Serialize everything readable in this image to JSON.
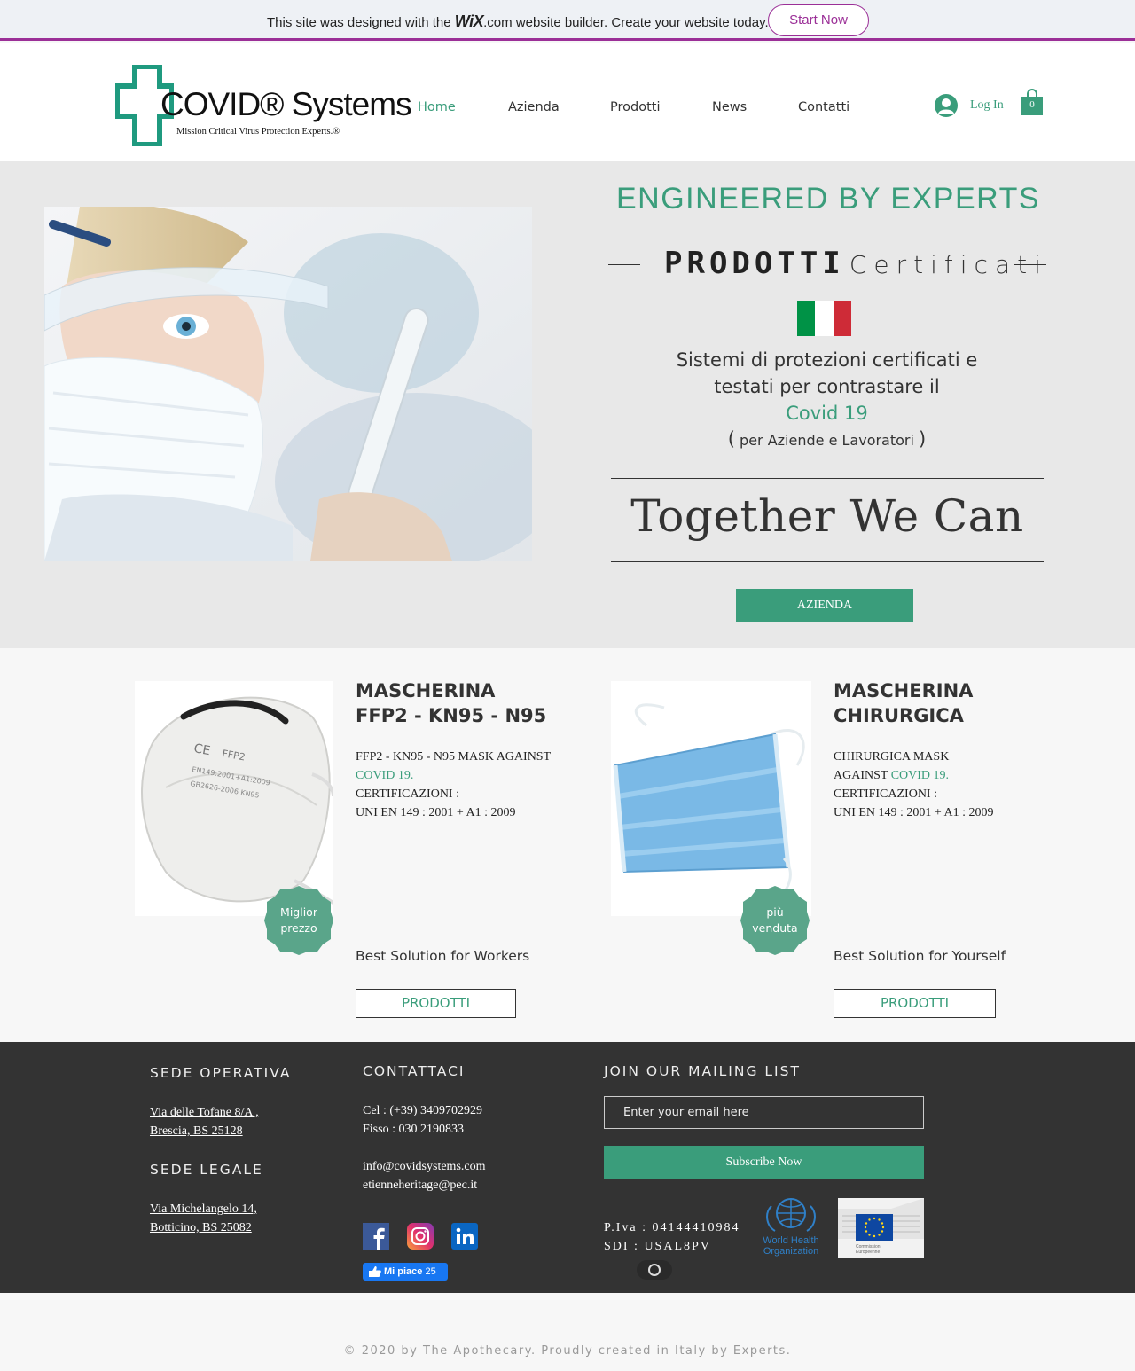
{
  "wix_banner": {
    "text_before": "This site was designed with the ",
    "logo": "WiX",
    "text_after": ".com website builder. Create your website today.",
    "start_button": "Start Now"
  },
  "header": {
    "logo_title": "COVID® Systems",
    "logo_tagline": "Mission Critical Virus Protection Experts.®",
    "nav": [
      "Home",
      "Azienda",
      "Prodotti",
      "News",
      "Contatti"
    ],
    "active_nav": "Home",
    "login_label": "Log In",
    "cart_count": "0"
  },
  "hero": {
    "title": "ENGINEERED BY EXPERTS",
    "cert_bold": "PRODOTTI",
    "cert_light": "Certificati",
    "desc_line1": "Sistemi di protezioni certificati e",
    "desc_line2": "testati per contrastare il",
    "desc_line3": "Covid 19",
    "sub_open": "(",
    "sub_text": "per Aziende e Lavoratori",
    "sub_close": ")",
    "slogan": "Together We Can",
    "button": "AZIENDA"
  },
  "products": [
    {
      "title_line1": "MASCHERINA",
      "title_line2": "FFP2 - KN95 - N95",
      "desc_line1": "FFP2 - KN95 - N95 MASK AGAINST",
      "desc_line2": "COVID 19.",
      "desc_line3": "CERTIFICAZIONI :",
      "desc_line4": "UNI EN 149 : 2001 + A1 : 2009",
      "badge_line1": "Miglior",
      "badge_line2": "prezzo",
      "tagline": "Best Solution for Workers",
      "button": "PRODOTTI"
    },
    {
      "title_line1": "MASCHERINA",
      "title_line2": "CHIRURGICA",
      "desc_line1": "CHIRURGICA MASK",
      "desc_line2a": "AGAINST ",
      "desc_line2b": "COVID 19.",
      "desc_line3": "CERTIFICAZIONI :",
      "desc_line4": "UNI EN 149 : 2001 + A1 : 2009",
      "badge_line1": "più",
      "badge_line2": "venduta",
      "tagline": "Best Solution for Yourself",
      "button": "PRODOTTI"
    }
  ],
  "mask_print": {
    "ce": "CE",
    "ffp2": "FFP2",
    "std1": "EN149:2001+A1:2009",
    "std2": "GB2626-2006  KN95"
  },
  "footer": {
    "sede_operativa": "SEDE OPERATIVA",
    "operativa_line1": "Via delle Tofane 8/A ,",
    "operativa_line2": "Brescia, BS 25128",
    "sede_legale": "SEDE LEGALE",
    "legale_line1": "Via Michelangelo 14,",
    "legale_line2": "Botticino, BS 25082",
    "contattaci": "CONTATTACI",
    "cel": "Cel : (+39) 3409702929",
    "fisso": "Fisso : 030 2190833",
    "email1": "info@covidsystems.com",
    "email2": "etienneheritage@pec.it",
    "fb_like_label": "Mi piace",
    "fb_like_count": "25",
    "mailing_title": "JOIN OUR MAILING LIST",
    "email_placeholder": "Enter your email here",
    "subscribe": "Subscribe Now",
    "piva": "P.Iva : 04144410984",
    "sdi": "SDI : USAL8PV",
    "who_line1": "World Health",
    "who_line2": "Organization",
    "eu_line1": "Commission",
    "eu_line2": "Européenne"
  },
  "copyright": "© 2020 by The Apothecary.  Proudly created in Italy by Experts.",
  "colors": {
    "accent": "#3a9d7b",
    "wix_purple": "#9b2f97",
    "footer_bg": "#333333",
    "hero_bg": "#e8e8e8"
  },
  "icons": [
    "user-icon",
    "shopping-bag-icon",
    "facebook-icon",
    "instagram-icon",
    "linkedin-icon",
    "facebook-like-icon",
    "italy-flag-icon"
  ]
}
